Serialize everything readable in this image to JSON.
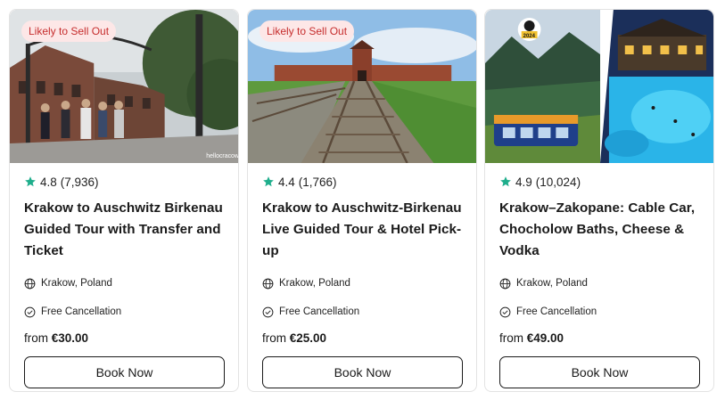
{
  "cards": [
    {
      "badge": "Likely to Sell Out",
      "image_watermark": "hellocracow",
      "rating": "4.8",
      "reviews": "(7,936)",
      "title": "Krakow to Auschwitz Birkenau Guided Tour with Transfer and Ticket",
      "location": "Krakow, Poland",
      "cancellation": "Free Cancellation",
      "price_prefix": "from",
      "price": "€30.00",
      "button": "Book Now"
    },
    {
      "badge": "Likely to Sell Out",
      "rating": "4.4",
      "reviews": "(1,766)",
      "title": "Krakow to Auschwitz-Birkenau Live Guided Tour & Hotel Pick-up",
      "location": "Krakow, Poland",
      "cancellation": "Free Cancellation",
      "price_prefix": "from",
      "price": "€25.00",
      "button": "Book Now"
    },
    {
      "award_year": "2024",
      "rating": "4.9",
      "reviews": "(10,024)",
      "title": "Krakow–Zakopane: Cable Car, Chocholow Baths, Cheese & Vodka",
      "location": "Krakow, Poland",
      "cancellation": "Free Cancellation",
      "price_prefix": "from",
      "price": "€49.00",
      "button": "Book Now"
    }
  ],
  "icons": {
    "rating": "star-icon",
    "location": "globe-icon",
    "cancellation": "check-circle-icon"
  },
  "colors": {
    "star": "#1fae8c",
    "badge_bg": "#fde7e7",
    "badge_text": "#c62d2d",
    "border": "#e3e3e3"
  }
}
